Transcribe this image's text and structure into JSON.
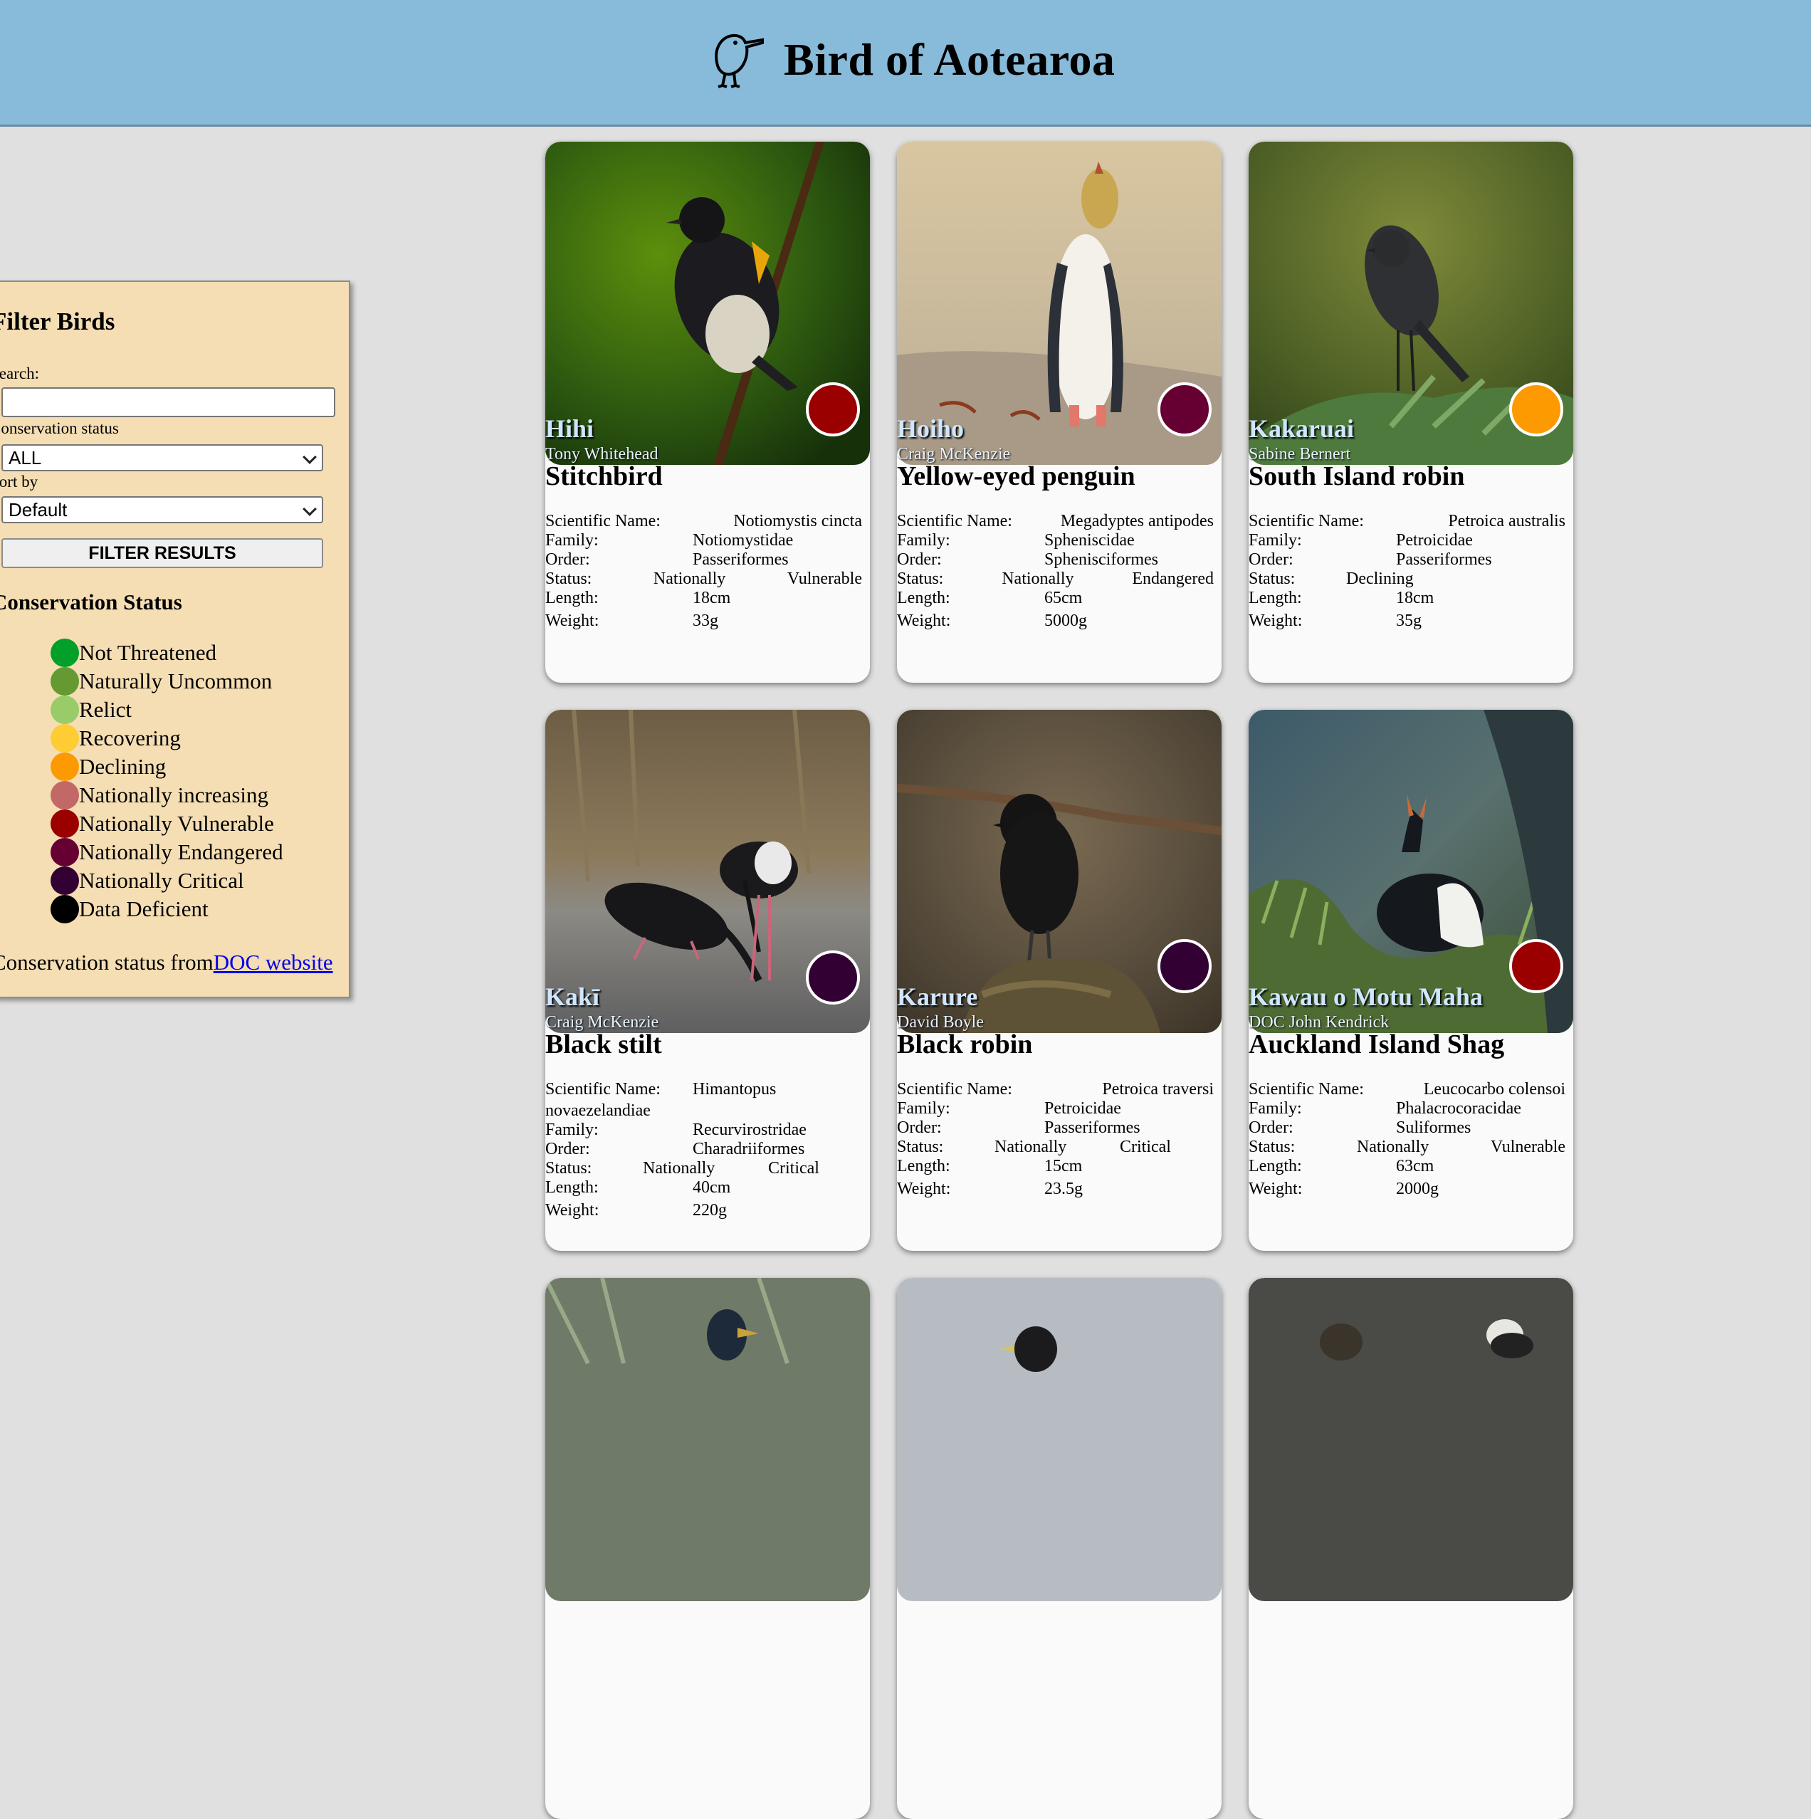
{
  "header": {
    "title": "Bird of Aotearoa",
    "logo_icon": "kiwi-bird-icon"
  },
  "sidebar": {
    "title": "Filter Birds",
    "search_label": "Search:",
    "search_value": "",
    "conservation_label": "Conservation status",
    "conservation_value": "ALL",
    "sort_label": "Sort by",
    "sort_value": "Default",
    "filter_button": "FILTER RESULTS",
    "legend_title": "Conservation Status",
    "legend": [
      {
        "label": "Not Threatened",
        "color": "#02a028"
      },
      {
        "label": "Naturally Uncommon",
        "color": "#649a31"
      },
      {
        "label": "Relict",
        "color": "#99cb68"
      },
      {
        "label": "Recovering",
        "color": "#fecc33"
      },
      {
        "label": "Declining",
        "color": "#fe9a01"
      },
      {
        "label": "Nationally increasing",
        "color": "#c26967"
      },
      {
        "label": "Nationally Vulnerable",
        "color": "#9b0000"
      },
      {
        "label": "Nationally Endangered",
        "color": "#660032"
      },
      {
        "label": "Nationally Critical",
        "color": "#320033"
      },
      {
        "label": "Data Deficient",
        "color": "#000000"
      }
    ],
    "footer_text": "Conservation status from",
    "footer_link": "DOC website"
  },
  "labels": {
    "scientific": "Scientific Name:",
    "family": "Family:",
    "order": "Order:",
    "status": "Status:",
    "length": "Length:",
    "weight": "Weight:"
  },
  "cards": [
    {
      "maori": "Hihi",
      "photographer": "Tony Whitehead",
      "english": "Stitchbird",
      "scientific": "Notiomystis cincta",
      "family": "Notiomystidae",
      "order": "Passeriformes",
      "status_word1": "Nationally",
      "status_word2": "Vulnerable",
      "length": "18cm",
      "weight": "33g",
      "status_color": "#9b0000"
    },
    {
      "maori": "Hoiho",
      "photographer": "Craig McKenzie",
      "english": "Yellow-eyed penguin",
      "scientific": "Megadyptes antipodes",
      "family": "Spheniscidae",
      "order": "Sphenisciformes",
      "status_word1": "Nationally",
      "status_word2": "Endangered",
      "length": "65cm",
      "weight": "5000g",
      "status_color": "#660032"
    },
    {
      "maori": "Kakaruai",
      "photographer": "Sabine Bernert",
      "english": "South Island robin",
      "scientific": "Petroica australis",
      "family": "Petroicidae",
      "order": "Passeriformes",
      "status_word1": "Declining",
      "status_word2": "",
      "length": "18cm",
      "weight": "35g",
      "status_color": "#fe9a01"
    },
    {
      "maori": "Kakī",
      "photographer": "Craig McKenzie",
      "english": "Black stilt",
      "scientific_line1": "Himantopus",
      "scientific_line2": "novaezelandiae",
      "family": "Recurvirostridae",
      "order": "Charadriiformes",
      "status_word1": "Nationally",
      "status_word2": "Critical",
      "length": "40cm",
      "weight": "220g",
      "status_color": "#320033"
    },
    {
      "maori": "Karure",
      "photographer": "David Boyle",
      "english": "Black robin",
      "scientific": "Petroica traversi",
      "family": "Petroicidae",
      "order": "Passeriformes",
      "status_word1": "Nationally",
      "status_word2": "Critical",
      "length": "15cm",
      "weight": "23.5g",
      "status_color": "#320033"
    },
    {
      "maori": "Kawau o Motu Maha",
      "photographer": "DOC John Kendrick",
      "english": "Auckland Island Shag",
      "scientific": "Leucocarbo colensoi",
      "family": "Phalacrocoracidae",
      "order": "Suliformes",
      "status_word1": "Nationally",
      "status_word2": "Vulnerable",
      "length": "63cm",
      "weight": "2000g",
      "status_color": "#9b0000"
    }
  ]
}
